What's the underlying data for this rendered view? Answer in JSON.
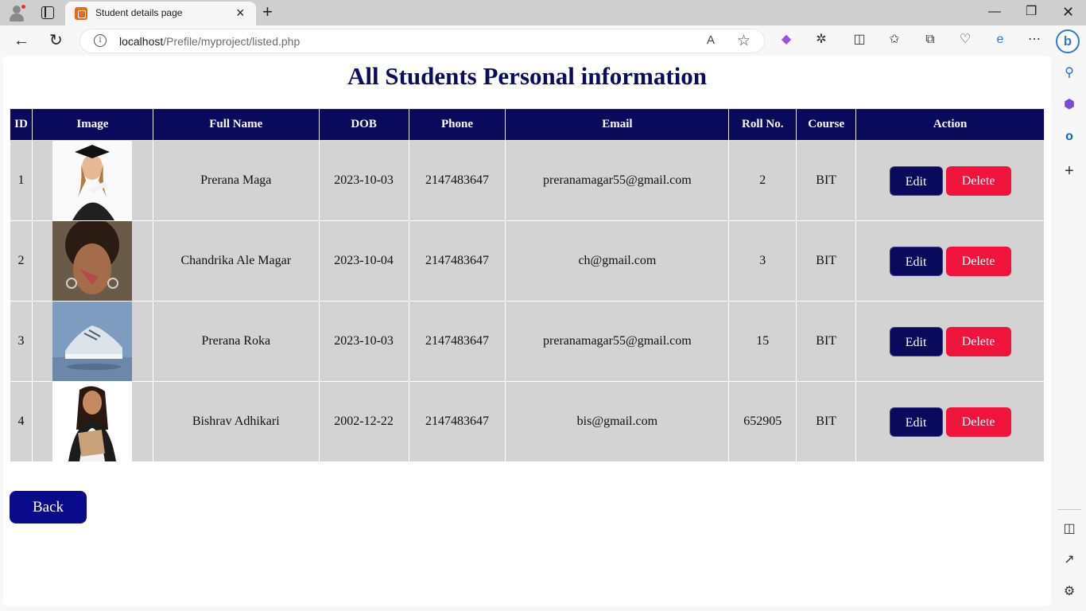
{
  "browser": {
    "tab_title": "Student details page",
    "url_host": "localhost",
    "url_path": "/Prefile/myproject/listed.php"
  },
  "page": {
    "title": "All Students Personal information",
    "back_label": "Back"
  },
  "table": {
    "headers": [
      "ID",
      "Image",
      "Full Name",
      "DOB",
      "Phone",
      "Email",
      "Roll No.",
      "Course",
      "Action"
    ],
    "rows": [
      {
        "id": "1",
        "image": "graduate-woman-photo",
        "full_name": "Prerana Maga",
        "dob": "2023-10-03",
        "phone": "2147483647",
        "email": "preranamagar55@gmail.com",
        "roll": "2",
        "course": "BIT"
      },
      {
        "id": "2",
        "image": "woman-portrait-photo",
        "full_name": "Chandrika Ale Magar",
        "dob": "2023-10-04",
        "phone": "2147483647",
        "email": "ch@gmail.com",
        "roll": "3",
        "course": "BIT"
      },
      {
        "id": "3",
        "image": "sneaker-photo",
        "full_name": "Prerana Roka",
        "dob": "2023-10-03",
        "phone": "2147483647",
        "email": "preranamagar55@gmail.com",
        "roll": "15",
        "course": "BIT"
      },
      {
        "id": "4",
        "image": "student-woman-photo",
        "full_name": "Bishrav Adhikari",
        "dob": "2002-12-22",
        "phone": "2147483647",
        "email": "bis@gmail.com",
        "roll": "652905",
        "course": "BIT"
      }
    ],
    "edit_label": "Edit",
    "delete_label": "Delete"
  },
  "colors": {
    "header_bg": "#0a0a5c",
    "row_bg": "#d3d3d3",
    "edit_bg": "#0a0a5c",
    "delete_bg": "#f0143c",
    "back_bg": "#0a0a8c",
    "title": "#0b0b5c"
  }
}
